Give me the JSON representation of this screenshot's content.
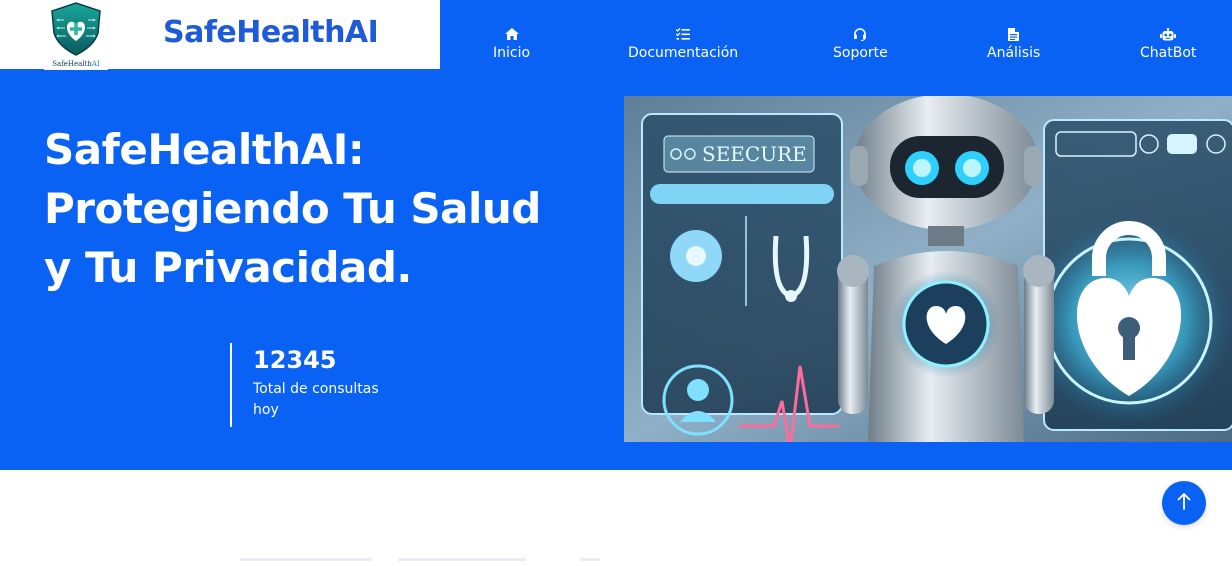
{
  "brand": {
    "name": "SafeHealthAI",
    "logo_text": "SafeHealth",
    "logo_text_ai": "AI",
    "logo_icon": "shield-heart-circuit-logo"
  },
  "nav": {
    "items": [
      {
        "label": "Inicio",
        "icon": "home-icon"
      },
      {
        "label": "Documentación",
        "icon": "list-check-icon"
      },
      {
        "label": "Soporte",
        "icon": "headset-icon"
      },
      {
        "label": "Análisis",
        "icon": "file-text-icon"
      },
      {
        "label": "ChatBot",
        "icon": "robot-icon"
      }
    ]
  },
  "hero": {
    "title_lines": [
      "SafeHealthAI:",
      "Protegiendo Tu Salud",
      "y Tu Privacidad."
    ],
    "stat": {
      "value": "12345",
      "label": "Total de consultas hoy"
    },
    "image_text": "SEECURE"
  },
  "colors": {
    "primary": "#0a62f5",
    "brand_text": "#1f5bd9",
    "white": "#ffffff"
  },
  "back_to_top": {
    "icon": "arrow-up-icon"
  }
}
